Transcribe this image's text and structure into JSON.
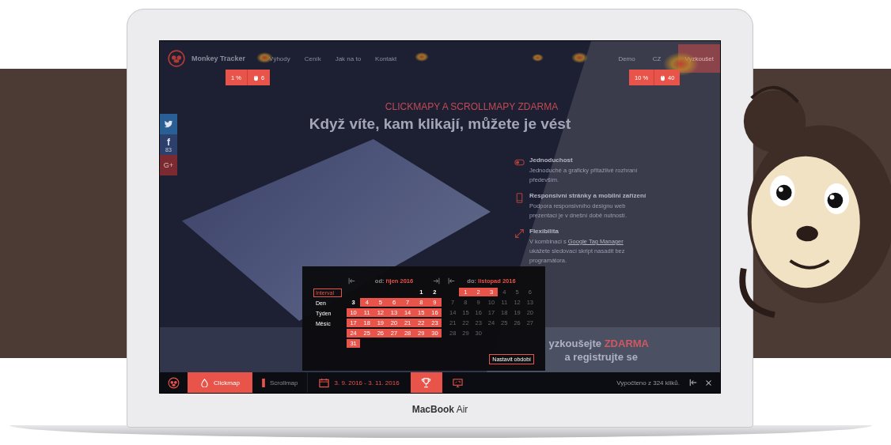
{
  "nav": {
    "brand": "Monkey Tracker",
    "links": [
      "Výhody",
      "Ceník",
      "Jak na to",
      "Kontakt"
    ],
    "right_links": [
      "Demo",
      "CZ"
    ],
    "cta": "Vyzkoušet"
  },
  "click_badges": [
    {
      "percent": "1 %",
      "clicks": "6"
    },
    {
      "percent": "10 %",
      "clicks": "40"
    }
  ],
  "social": [
    {
      "kind": "twitter"
    },
    {
      "kind": "facebook",
      "glyph": "f",
      "count": "83"
    },
    {
      "kind": "googleplus",
      "glyph": "G+"
    }
  ],
  "hero": {
    "kicker": "CLICKMAPY A SCROLLMAPY ZDARMA",
    "title": "Když víte, kam klikají, můžete je vést"
  },
  "features": [
    {
      "kind": "toggle",
      "title": "Jednoduchost",
      "lines": [
        "Jednoduché a graficky přitažlivé rozhraní",
        "především."
      ]
    },
    {
      "kind": "mobile",
      "title": "Responsivní stránky a mobilní zařízení",
      "lines": [
        "Podpora responsivního designu web",
        "prezentací je v dnešní době nutností."
      ]
    },
    {
      "kind": "resize",
      "title": "Flexibilita",
      "intro": "V kombinaci s",
      "link": "Google Tag Manager",
      "lines": [
        "ukážete sledovací skript nasadit bez",
        "programátora."
      ]
    }
  ],
  "cta_band": {
    "text": "yzkoušejte",
    "highlight": "ZDARMA",
    "line2": "a registrujte se"
  },
  "calendar": {
    "modes": [
      {
        "label": "Interval",
        "selected": true
      },
      {
        "label": "Den",
        "selected": false
      },
      {
        "label": "Týden",
        "selected": false
      },
      {
        "label": "Měsíc",
        "selected": false
      }
    ],
    "months": [
      {
        "prefix": "od:",
        "name": "říjen 2016",
        "weeks": [
          [
            {
              "d": "1",
              "selected": false,
              "disabled": false
            },
            {
              "d": "2",
              "selected": false,
              "disabled": false
            }
          ],
          [
            {
              "d": "3",
              "selected": false,
              "disabled": false
            },
            {
              "d": "4",
              "selected": true,
              "disabled": false
            },
            {
              "d": "5",
              "selected": true,
              "disabled": false
            },
            {
              "d": "6",
              "selected": true,
              "disabled": false
            },
            {
              "d": "7",
              "selected": true,
              "disabled": false
            },
            {
              "d": "8",
              "selected": true,
              "disabled": false
            },
            {
              "d": "9",
              "selected": true,
              "disabled": false
            }
          ],
          [
            {
              "d": "10",
              "selected": true,
              "disabled": false
            },
            {
              "d": "11",
              "selected": true,
              "disabled": false
            },
            {
              "d": "12",
              "selected": true,
              "disabled": false
            },
            {
              "d": "13",
              "selected": true,
              "disabled": false
            },
            {
              "d": "14",
              "selected": true,
              "disabled": false
            },
            {
              "d": "15",
              "selected": true,
              "disabled": false
            },
            {
              "d": "16",
              "selected": true,
              "disabled": false
            }
          ],
          [
            {
              "d": "17",
              "selected": true,
              "disabled": false
            },
            {
              "d": "18",
              "selected": true,
              "disabled": false
            },
            {
              "d": "19",
              "selected": true,
              "disabled": false
            },
            {
              "d": "20",
              "selected": true,
              "disabled": false
            },
            {
              "d": "21",
              "selected": true,
              "disabled": false
            },
            {
              "d": "22",
              "selected": true,
              "disabled": false
            },
            {
              "d": "23",
              "selected": true,
              "disabled": false
            }
          ],
          [
            {
              "d": "24",
              "selected": true,
              "disabled": false
            },
            {
              "d": "25",
              "selected": true,
              "disabled": false
            },
            {
              "d": "26",
              "selected": true,
              "disabled": false
            },
            {
              "d": "27",
              "selected": true,
              "disabled": false
            },
            {
              "d": "28",
              "selected": true,
              "disabled": false
            },
            {
              "d": "29",
              "selected": true,
              "disabled": false
            },
            {
              "d": "30",
              "selected": true,
              "disabled": false
            }
          ],
          [
            {
              "d": "31",
              "selected": true,
              "disabled": false
            }
          ]
        ]
      },
      {
        "prefix": "do:",
        "name": "listopad 2016",
        "weeks": [
          [
            {
              "d": "1",
              "selected": true,
              "disabled": false
            },
            {
              "d": "2",
              "selected": true,
              "disabled": false
            },
            {
              "d": "3",
              "selected": true,
              "disabled": false
            },
            {
              "d": "4",
              "selected": false,
              "disabled": true
            },
            {
              "d": "5",
              "selected": false,
              "disabled": true
            },
            {
              "d": "6",
              "selected": false,
              "disabled": true
            }
          ],
          [
            {
              "d": "7",
              "selected": false,
              "disabled": true
            },
            {
              "d": "8",
              "selected": false,
              "disabled": true
            },
            {
              "d": "9",
              "selected": false,
              "disabled": true
            },
            {
              "d": "10",
              "selected": false,
              "disabled": true
            },
            {
              "d": "11",
              "selected": false,
              "disabled": true
            },
            {
              "d": "12",
              "selected": false,
              "disabled": true
            },
            {
              "d": "13",
              "selected": false,
              "disabled": true
            }
          ],
          [
            {
              "d": "14",
              "selected": false,
              "disabled": true
            },
            {
              "d": "15",
              "selected": false,
              "disabled": true
            },
            {
              "d": "16",
              "selected": false,
              "disabled": true
            },
            {
              "d": "17",
              "selected": false,
              "disabled": true
            },
            {
              "d": "18",
              "selected": false,
              "disabled": true
            },
            {
              "d": "19",
              "selected": false,
              "disabled": true
            },
            {
              "d": "20",
              "selected": false,
              "disabled": true
            }
          ],
          [
            {
              "d": "21",
              "selected": false,
              "disabled": true
            },
            {
              "d": "22",
              "selected": false,
              "disabled": true
            },
            {
              "d": "23",
              "selected": false,
              "disabled": true
            },
            {
              "d": "24",
              "selected": false,
              "disabled": true
            },
            {
              "d": "25",
              "selected": false,
              "disabled": true
            },
            {
              "d": "26",
              "selected": false,
              "disabled": true
            },
            {
              "d": "27",
              "selected": false,
              "disabled": true
            }
          ],
          [
            {
              "d": "28",
              "selected": false,
              "disabled": true
            },
            {
              "d": "29",
              "selected": false,
              "disabled": true
            },
            {
              "d": "30",
              "selected": false,
              "disabled": true
            }
          ]
        ]
      }
    ],
    "apply": "Nastavit období"
  },
  "toolbar": {
    "tabs": [
      {
        "kind": "click",
        "label": "Clickmap",
        "selected": true
      },
      {
        "kind": "scroll",
        "label": "Scrollmap",
        "selected": false
      }
    ],
    "date_range": "3. 9. 2016 - 3. 11. 2016",
    "tools": [
      {
        "kind": "trophy",
        "selected": true
      },
      {
        "kind": "screen",
        "selected": false
      }
    ],
    "status": "Vypočteno z 324 kliků."
  },
  "device_label": "**MacBook** Air"
}
